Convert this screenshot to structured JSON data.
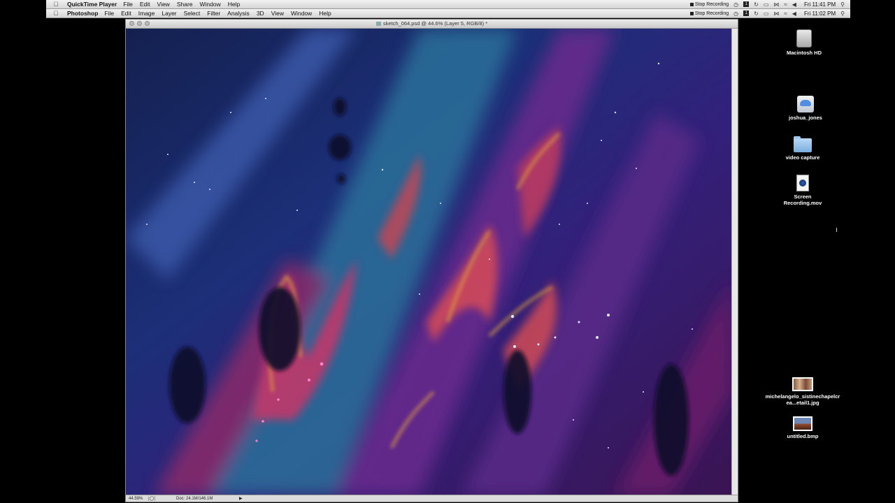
{
  "menubar_top": {
    "app": "QuickTime Player",
    "items": [
      "File",
      "Edit",
      "View",
      "Share",
      "Window",
      "Help"
    ],
    "stop_recording": "Stop Recording",
    "sq_label": "1",
    "clock": "Fri 11:41 PM"
  },
  "menubar_second": {
    "app": "Photoshop",
    "items": [
      "File",
      "Edit",
      "Image",
      "Layer",
      "Select",
      "Filter",
      "Analysis",
      "3D",
      "View",
      "Window",
      "Help"
    ],
    "stop_recording": "Stop Recording",
    "sq_label": "1",
    "clock": "Fri 11:02 PM"
  },
  "document": {
    "title": "sketch_064.psd @ 44.6% (Layer 5, RGB/8) *"
  },
  "statusbar": {
    "zoom": "44.59%",
    "doc_info": "Doc: 24.1M/146.1M"
  },
  "desktop": {
    "items": [
      {
        "label": "Macintosh HD",
        "icon": "hard-drive-icon"
      },
      {
        "label": "joshua_jones",
        "icon": "user-home-icon"
      },
      {
        "label": "video capture",
        "icon": "folder-icon"
      },
      {
        "label": "Screen Recording.mov",
        "icon": "movie-file-icon"
      },
      {
        "label": "michelangelo_sistinechapelcrea...etail1.jpg",
        "icon": "jpg-image-icon"
      },
      {
        "label": "untitled.bmp",
        "icon": "bmp-image-icon"
      }
    ]
  }
}
